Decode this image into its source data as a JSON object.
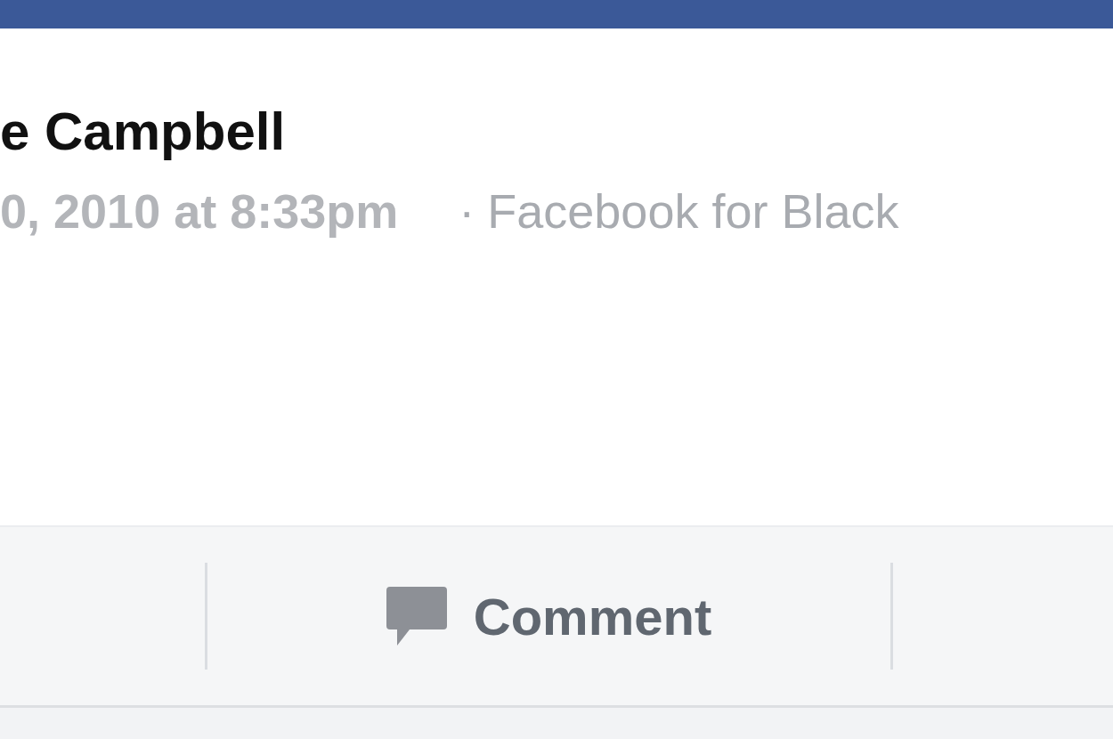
{
  "post": {
    "author": "e Campbell",
    "timestamp": "0, 2010 at 8:33pm",
    "separator": "·",
    "source": "Facebook for Black"
  },
  "actions": [
    {
      "kind": "comment",
      "label": "Comment"
    }
  ]
}
